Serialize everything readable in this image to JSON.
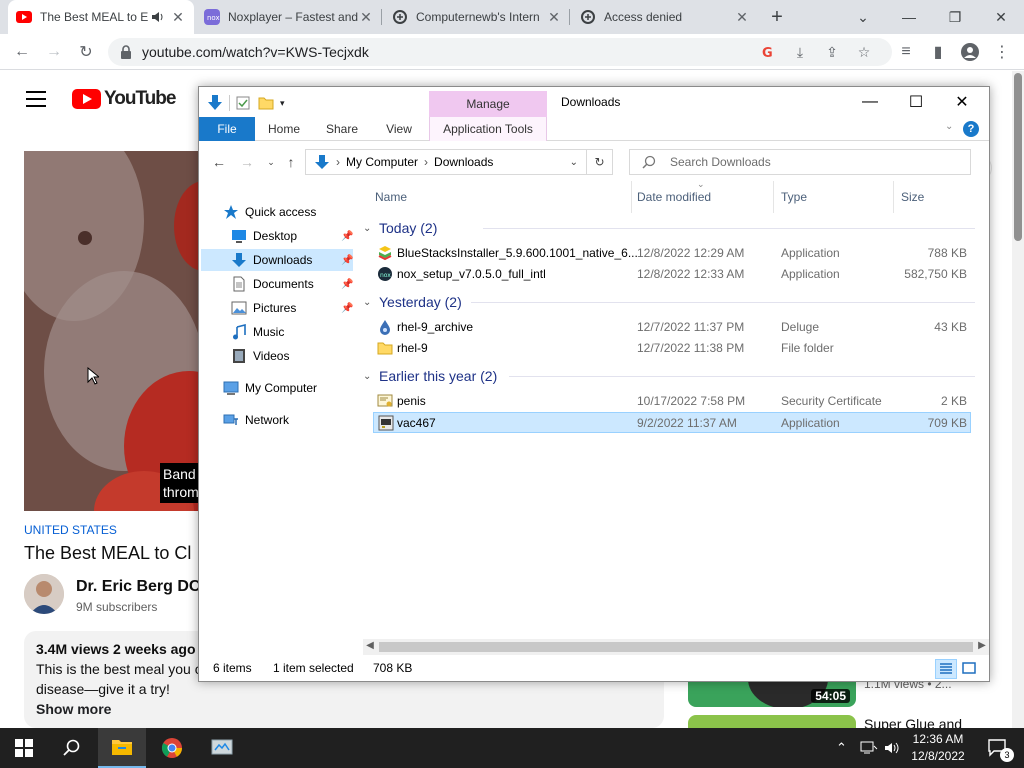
{
  "browser": {
    "tabs": [
      {
        "title": "The Best MEAL to E",
        "active": true,
        "icon": "youtube-icon"
      },
      {
        "title": "Noxplayer – Fastest and",
        "active": false,
        "icon": "noxplayer-icon"
      },
      {
        "title": "Computernewb's Intern",
        "active": false,
        "icon": "computernewb-icon"
      },
      {
        "title": "Access denied",
        "active": false,
        "icon": "computernewb-icon"
      }
    ],
    "url": "youtube.com/watch?v=KWS-Tecjxdk"
  },
  "youtube": {
    "logo_text": "YouTube",
    "caption": "Band throm",
    "country": "UNITED STATES",
    "video_title": "The Best MEAL to Cl",
    "channel": "Dr. Eric Berg DC",
    "subscribers": "9M subscribers",
    "views": "3.4M views  2 weeks ago",
    "desc_line1": "This is the best meal you c",
    "desc_line2": "disease—give it a try!",
    "show_more": "Show more",
    "rec1_duration": "54:05",
    "rec1_meta": "1.1M views  • 2...",
    "rec2_title": "Super Glue and"
  },
  "explorer": {
    "title": "Downloads",
    "context_tab": "Manage",
    "ribbon_tabs": [
      "File",
      "Home",
      "Share",
      "View",
      "Application Tools"
    ],
    "breadcrumb": [
      "My Computer",
      "Downloads"
    ],
    "search_placeholder": "Search Downloads",
    "nav": [
      {
        "label": "Quick access",
        "icon": "star-icon",
        "pinned": false,
        "selected": false
      },
      {
        "label": "Desktop",
        "icon": "desktop-icon",
        "pinned": true,
        "selected": false
      },
      {
        "label": "Downloads",
        "icon": "download-arrow-icon",
        "pinned": true,
        "selected": true
      },
      {
        "label": "Documents",
        "icon": "document-icon",
        "pinned": true,
        "selected": false
      },
      {
        "label": "Pictures",
        "icon": "pictures-icon",
        "pinned": true,
        "selected": false
      },
      {
        "label": "Music",
        "icon": "music-icon",
        "pinned": false,
        "selected": false
      },
      {
        "label": "Videos",
        "icon": "videos-icon",
        "pinned": false,
        "selected": false
      },
      {
        "label": "My Computer",
        "icon": "computer-icon",
        "pinned": false,
        "selected": false
      },
      {
        "label": "Network",
        "icon": "network-icon",
        "pinned": false,
        "selected": false
      }
    ],
    "columns": [
      "Name",
      "Date modified",
      "Type",
      "Size"
    ],
    "groups": [
      {
        "label": "Today (2)",
        "files": [
          {
            "name": "BlueStacksInstaller_5.9.600.1001_native_6...",
            "date": "12/8/2022 12:29 AM",
            "type": "Application",
            "size": "788 KB",
            "icon": "bluestacks-icon"
          },
          {
            "name": "nox_setup_v7.0.5.0_full_intl",
            "date": "12/8/2022 12:33 AM",
            "type": "Application",
            "size": "582,750 KB",
            "icon": "nox-icon"
          }
        ]
      },
      {
        "label": "Yesterday (2)",
        "files": [
          {
            "name": "rhel-9_archive",
            "date": "12/7/2022 11:37 PM",
            "type": "Deluge",
            "size": "43 KB",
            "icon": "deluge-icon"
          },
          {
            "name": "rhel-9",
            "date": "12/7/2022 11:38 PM",
            "type": "File folder",
            "size": "",
            "icon": "folder-icon"
          }
        ]
      },
      {
        "label": "Earlier this year (2)",
        "files": [
          {
            "name": "penis",
            "date": "10/17/2022 7:58 PM",
            "type": "Security Certificate",
            "size": "2 KB",
            "icon": "certificate-icon"
          },
          {
            "name": "vac467",
            "date": "9/2/2022 11:37 AM",
            "type": "Application",
            "size": "709 KB",
            "icon": "application-icon",
            "selected": true
          }
        ]
      }
    ],
    "status": {
      "items": "6 items",
      "selected": "1 item selected",
      "size": "708 KB"
    }
  },
  "taskbar": {
    "time": "12:36 AM",
    "date": "12/8/2022",
    "notifications": "3"
  }
}
